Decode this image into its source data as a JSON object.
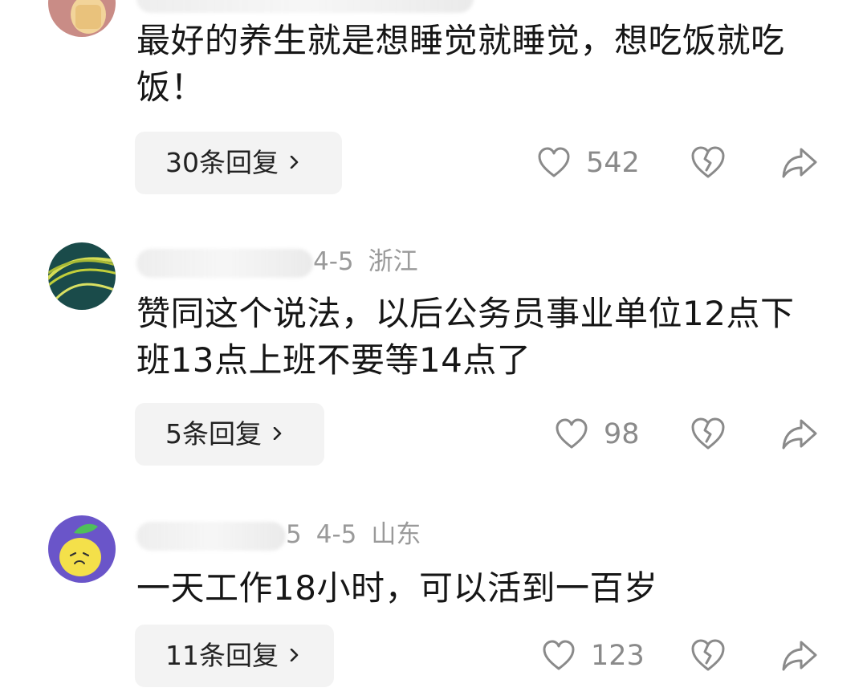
{
  "comments": [
    {
      "id": "c1",
      "meta_visible": "",
      "text": "最好的养生就是想睡觉就睡觉，想吃饭就吃饭！",
      "replies_label": "30条回复",
      "likes": "542",
      "icons": [
        "heart-icon",
        "broken-heart-icon",
        "share-icon"
      ]
    },
    {
      "id": "c2",
      "meta_visible": "4-5",
      "region": "浙江",
      "text": "赞同这个说法，以后公务员事业单位12点下班13点上班不要等14点了",
      "replies_label": "5条回复",
      "likes": "98",
      "icons": [
        "heart-icon",
        "broken-heart-icon",
        "share-icon"
      ]
    },
    {
      "id": "c3",
      "meta_visible": "5",
      "date": "4-5",
      "region": "山东",
      "text": "一天工作18小时，可以活到一百岁",
      "replies_label": "11条回复",
      "likes": "123",
      "icons": [
        "heart-icon",
        "broken-heart-icon",
        "share-icon"
      ]
    }
  ]
}
